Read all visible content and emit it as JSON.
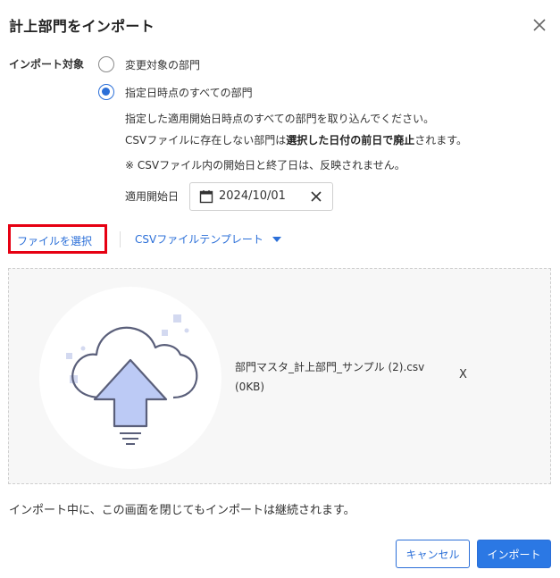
{
  "dialog": {
    "title": "計上部門をインポート",
    "close_icon": "close-icon"
  },
  "import_target": {
    "label": "インポート対象",
    "options": [
      {
        "label": "変更対象の部門",
        "selected": false
      },
      {
        "label": "指定日時点のすべての部門",
        "selected": true
      }
    ],
    "description_1": "指定した適用開始日時点のすべての部門を取り込んでください。",
    "description_2_prefix": "CSVファイルに存在しない部門は",
    "description_2_bold": "選択した日付の前日で廃止",
    "description_2_suffix": "されます。",
    "description_3": "※ CSVファイル内の開始日と終了日は、反映されません。"
  },
  "start_date": {
    "label": "適用開始日",
    "value": "2024/10/01",
    "icon": "calendar-icon",
    "clear_icon": "clear-icon"
  },
  "file_actions": {
    "select_label": "ファイルを選択",
    "template_label": "CSVファイルテンプレート",
    "highlight_color": "#e60012"
  },
  "dropzone": {
    "icon": "cloud-upload-icon",
    "file_name": "部門マスタ_計上部門_サンプル (2).csv",
    "file_size": "(0KB)",
    "remove_label": "X"
  },
  "note": "インポート中に、この画面を閉じてもインポートは継続されます。",
  "buttons": {
    "cancel": "キャンセル",
    "import": "インポート"
  },
  "colors": {
    "accent": "#2b78e4",
    "link": "#2b6fd8"
  }
}
